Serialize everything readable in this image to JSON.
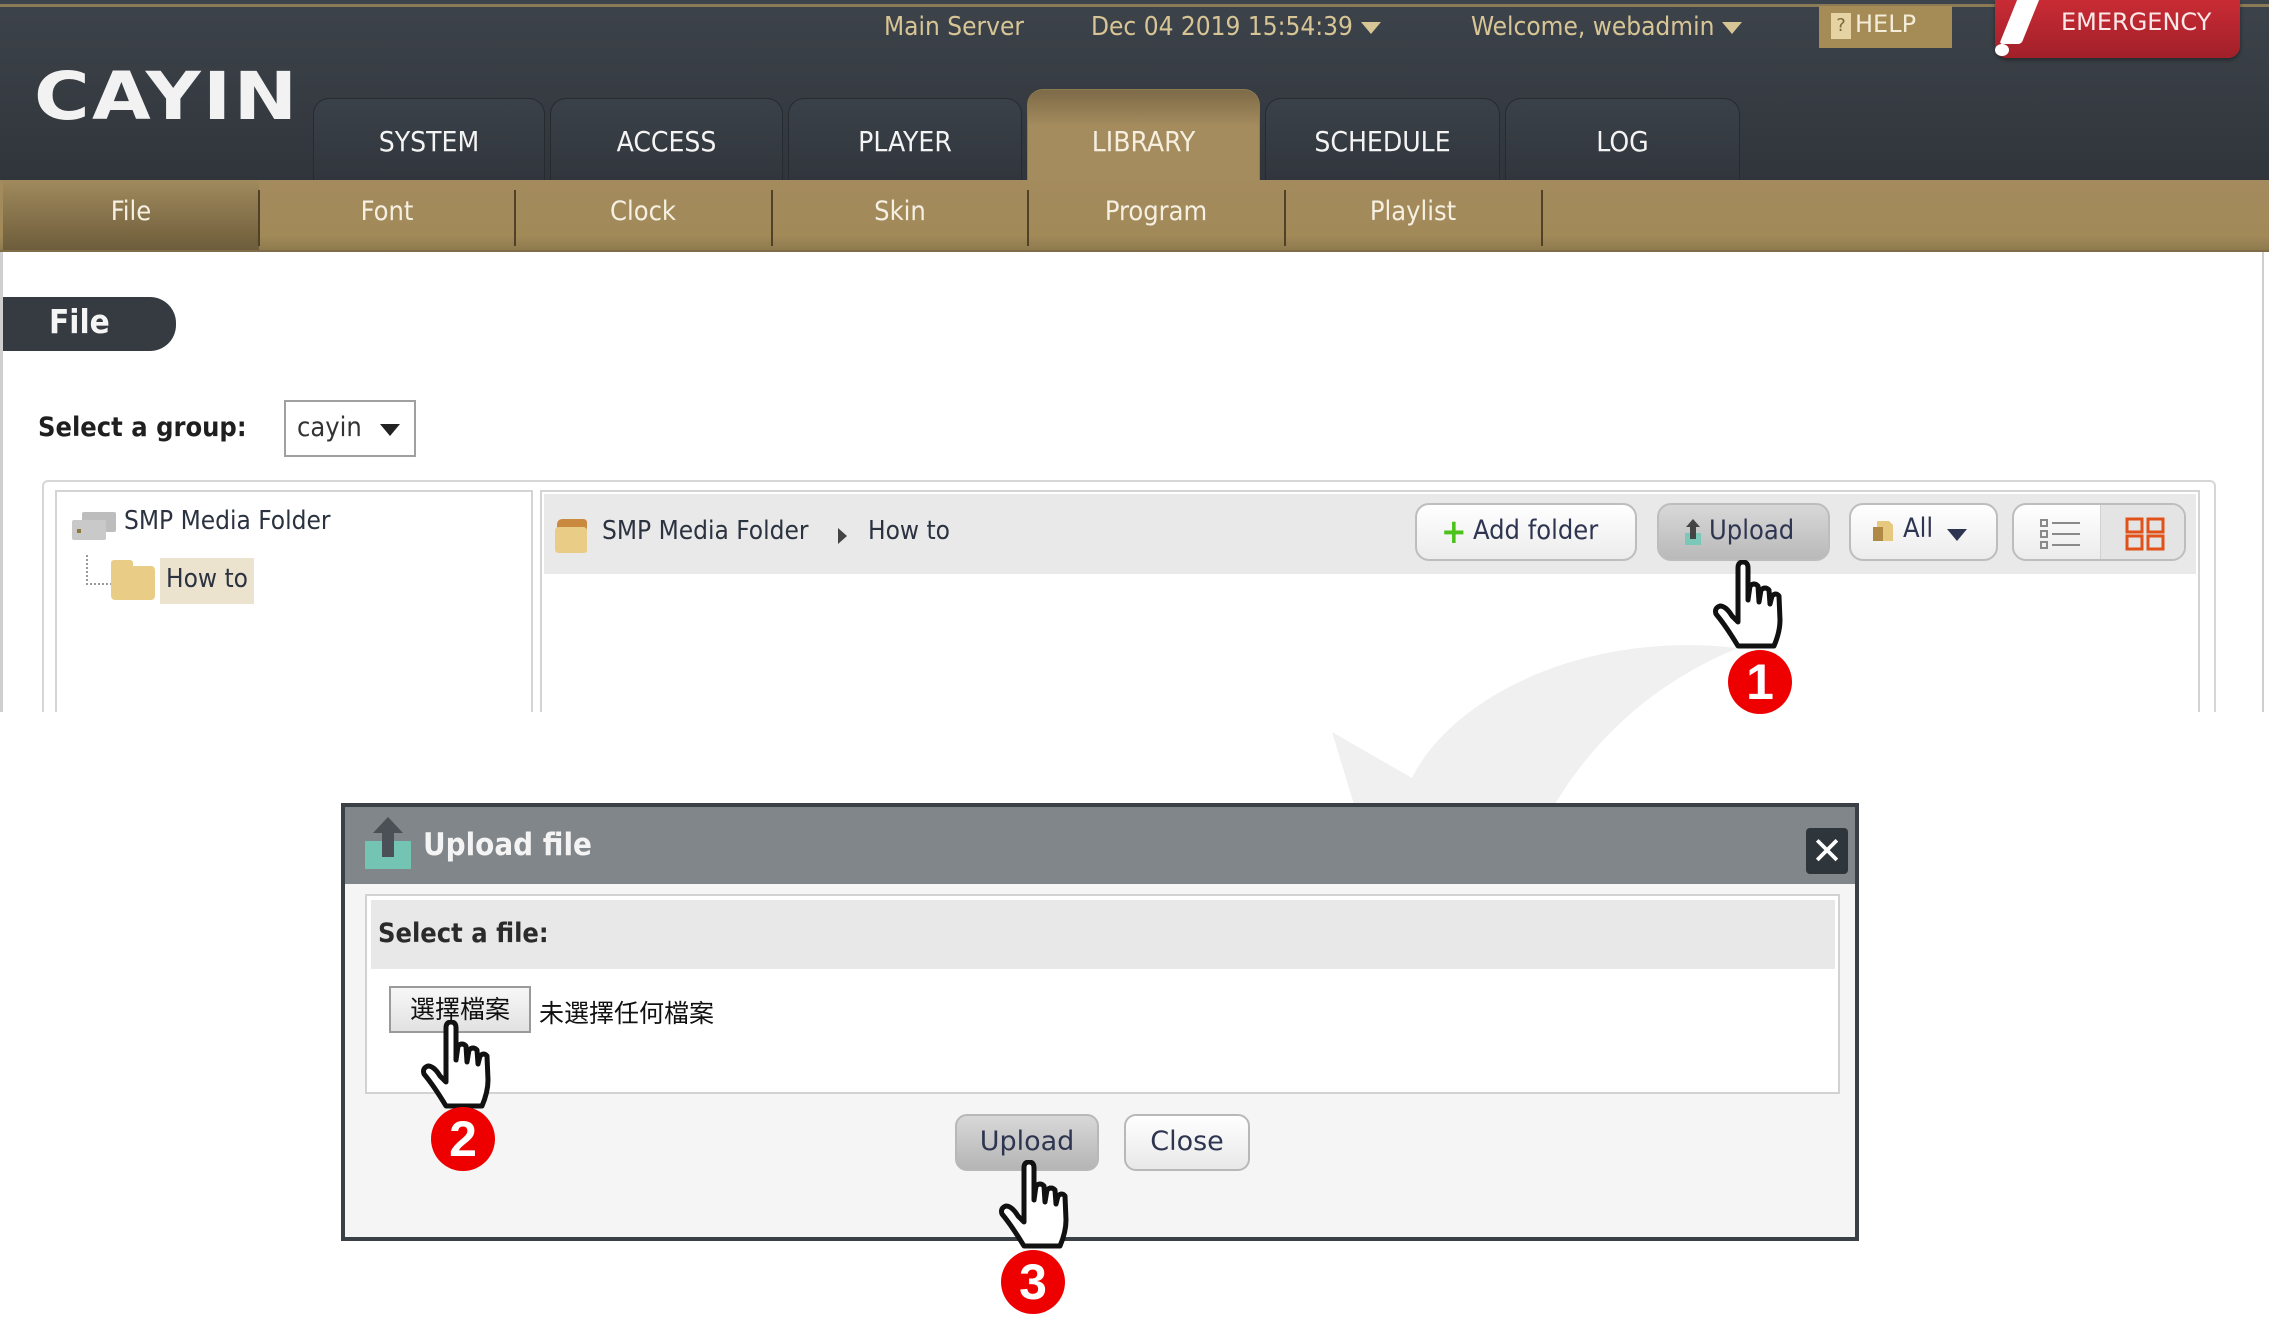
{
  "header": {
    "logo": "CAYIN",
    "server": "Main Server",
    "datetime": "Dec 04 2019 15:54:39",
    "welcome": "Welcome, webadmin",
    "help_label": "HELP",
    "help_glyph": "?",
    "emergency_label": "EMERGENCY"
  },
  "main_tabs": [
    {
      "label": "SYSTEM",
      "active": false
    },
    {
      "label": "ACCESS",
      "active": false
    },
    {
      "label": "PLAYER",
      "active": false
    },
    {
      "label": "LIBRARY",
      "active": true
    },
    {
      "label": "SCHEDULE",
      "active": false
    },
    {
      "label": "LOG",
      "active": false
    }
  ],
  "sub_tabs": [
    {
      "label": "File",
      "active": true
    },
    {
      "label": "Font",
      "active": false
    },
    {
      "label": "Clock",
      "active": false
    },
    {
      "label": "Skin",
      "active": false
    },
    {
      "label": "Program",
      "active": false
    },
    {
      "label": "Playlist",
      "active": false
    }
  ],
  "page": {
    "title": "File",
    "group_label": "Select a group:",
    "group_value": "cayin"
  },
  "tree": {
    "root": "SMP Media Folder",
    "children": [
      "How to"
    ],
    "selected": "How to"
  },
  "breadcrumb": [
    "SMP Media Folder",
    "How to"
  ],
  "toolbar": {
    "add_folder": "Add folder",
    "upload": "Upload",
    "filter": "All",
    "view_list_icon": "list-view-icon",
    "view_grid_icon": "grid-view-icon"
  },
  "dialog": {
    "title": "Upload file",
    "close_glyph": "✕",
    "select_label": "Select a file:",
    "choose_button": "選擇檔案",
    "no_file_text": "未選擇任何檔案",
    "upload_button": "Upload",
    "close_button": "Close"
  },
  "annotations": {
    "steps": [
      "1",
      "2",
      "3"
    ],
    "marker_color": "#ee0000"
  },
  "colors": {
    "header_dark": "#353b41",
    "gold": "#a48b5e",
    "emergency": "#c92b34"
  }
}
